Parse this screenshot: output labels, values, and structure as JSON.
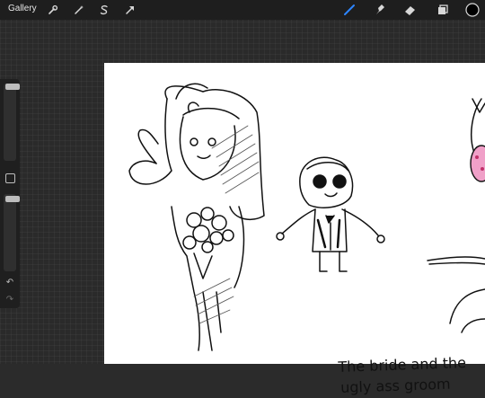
{
  "topbar": {
    "gallery_label": "Gallery",
    "tools_left": [
      "wrench-icon",
      "magic-wand-icon",
      "selection-icon",
      "transform-arrow-icon"
    ],
    "tools_right": [
      "brush-icon",
      "smudge-icon",
      "eraser-icon",
      "layers-icon",
      "color-swatch"
    ],
    "active_tool": "brush",
    "accent_color": "#2d86ff",
    "current_color": "#000000"
  },
  "sidebar": {
    "brush_size_level": 0.05,
    "opacity_level": 0.05,
    "controls": [
      "brush-size-slider",
      "modify-button",
      "opacity-slider",
      "undo-icon",
      "redo-icon"
    ]
  },
  "canvas": {
    "background": "#ffffff",
    "caption_line1": "The bride and the",
    "caption_line2": "ugly ass groom"
  }
}
